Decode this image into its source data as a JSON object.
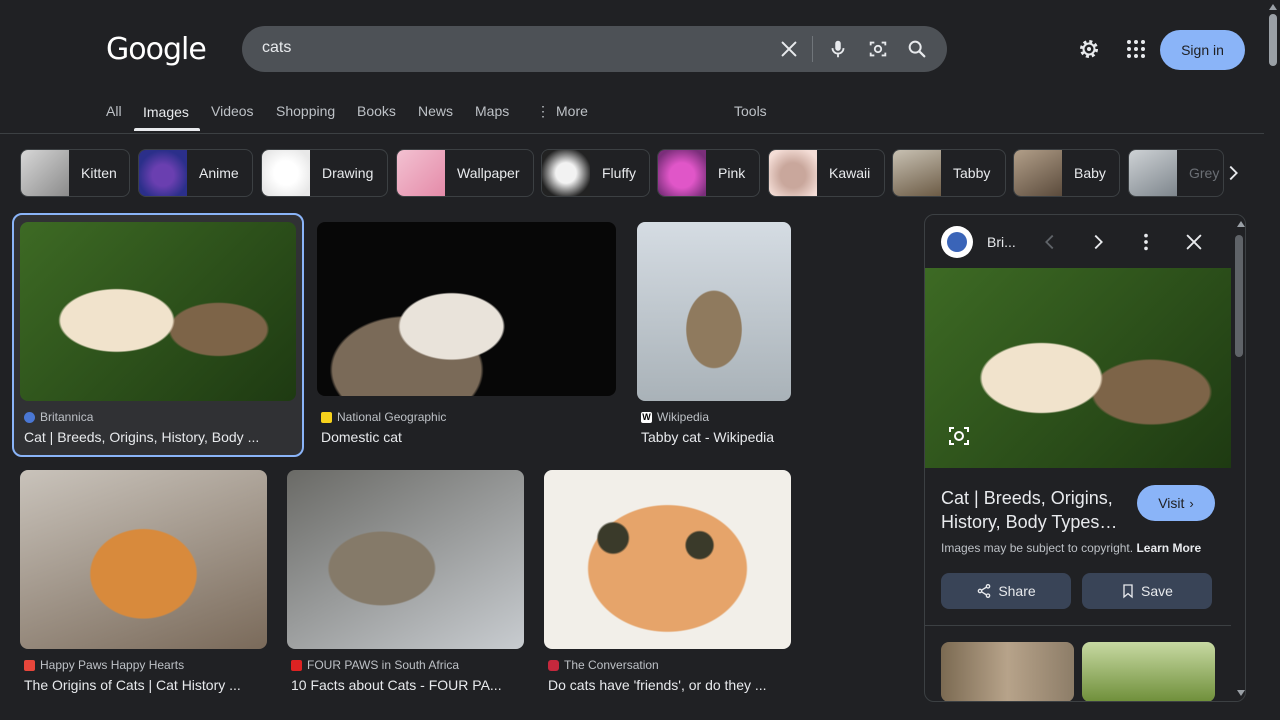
{
  "header": {
    "logo_text": "Google",
    "search_value": "cats",
    "signin_label": "Sign in"
  },
  "tabs": [
    {
      "label": "All"
    },
    {
      "label": "Images"
    },
    {
      "label": "Videos"
    },
    {
      "label": "Shopping"
    },
    {
      "label": "Books"
    },
    {
      "label": "News"
    },
    {
      "label": "Maps"
    },
    {
      "label": "More"
    }
  ],
  "tools_label": "Tools",
  "chips": [
    {
      "label": "Kitten"
    },
    {
      "label": "Anime"
    },
    {
      "label": "Drawing"
    },
    {
      "label": "Wallpaper"
    },
    {
      "label": "Fluffy"
    },
    {
      "label": "Pink"
    },
    {
      "label": "Kawaii"
    },
    {
      "label": "Tabby"
    },
    {
      "label": "Baby"
    },
    {
      "label": "Grey"
    }
  ],
  "results": [
    {
      "source": "Britannica",
      "title": "Cat | Breeds, Origins, History, Body ..."
    },
    {
      "source": "National Geographic",
      "title": "Domestic cat"
    },
    {
      "source": "Wikipedia",
      "title": "Tabby cat - Wikipedia"
    },
    {
      "source": "Happy Paws Happy Hearts",
      "title": "The Origins of Cats | Cat History ..."
    },
    {
      "source": "FOUR PAWS in South Africa",
      "title": "10 Facts about Cats - FOUR PA..."
    },
    {
      "source": "The Conversation",
      "title": "Do cats have 'friends', or do they ..."
    }
  ],
  "panel": {
    "site_short": "Bri...",
    "title": "Cat | Breeds, Origins, History, Body Types…",
    "visit_label": "Visit",
    "copyright_text": "Images may be subject to copyright.",
    "learn_more": "Learn More",
    "share_label": "Share",
    "save_label": "Save"
  },
  "colors": {
    "background": "#202124",
    "accent": "#8ab4f8",
    "search_bar": "#4d5156"
  }
}
